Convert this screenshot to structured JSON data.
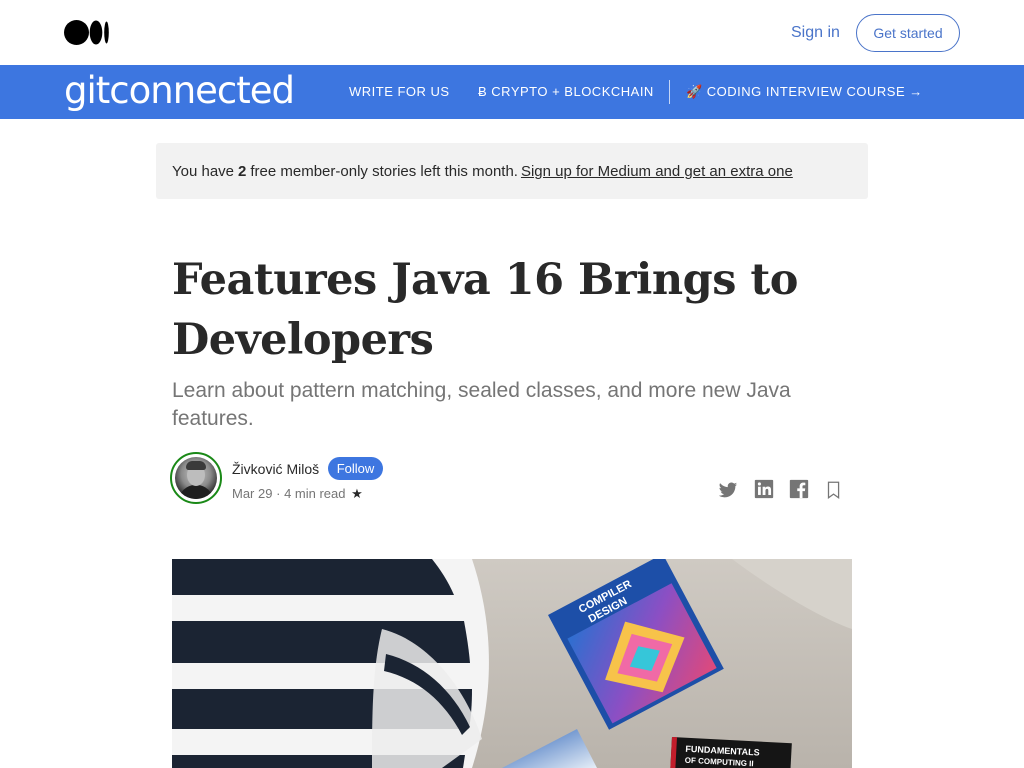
{
  "topbar": {
    "signin_label": "Sign in",
    "getstarted_label": "Get started"
  },
  "publication": {
    "name": "gitconnected",
    "nav": [
      {
        "label": "WRITE FOR US"
      },
      {
        "label": "Ƀ CRYPTO + BLOCKCHAIN"
      },
      {
        "label": "🚀 CODING INTERVIEW COURSE →"
      }
    ]
  },
  "banner": {
    "prefix": "You have",
    "count": "2",
    "middle": "free member-only stories left this month.",
    "link": "Sign up for Medium and get an extra one"
  },
  "article": {
    "title": "Features Java 16 Brings to Developers",
    "subtitle": "Learn about pattern matching, sealed classes, and more new Java features.",
    "author": "Živković Miloš",
    "follow_label": "Follow",
    "date": "Mar 29",
    "separator": "·",
    "read_time": "4 min read",
    "star": "★"
  },
  "hero": {
    "book1_line1": "COMPILER",
    "book1_line2": "DESIGN",
    "book2_line1": "FUNDAMENTALS",
    "book2_line2": "OF COMPUTING II"
  },
  "colors": {
    "brand_blue": "#3d76e0",
    "link_blue": "#4a74c9",
    "follow_green_ring": "#1a8917"
  }
}
